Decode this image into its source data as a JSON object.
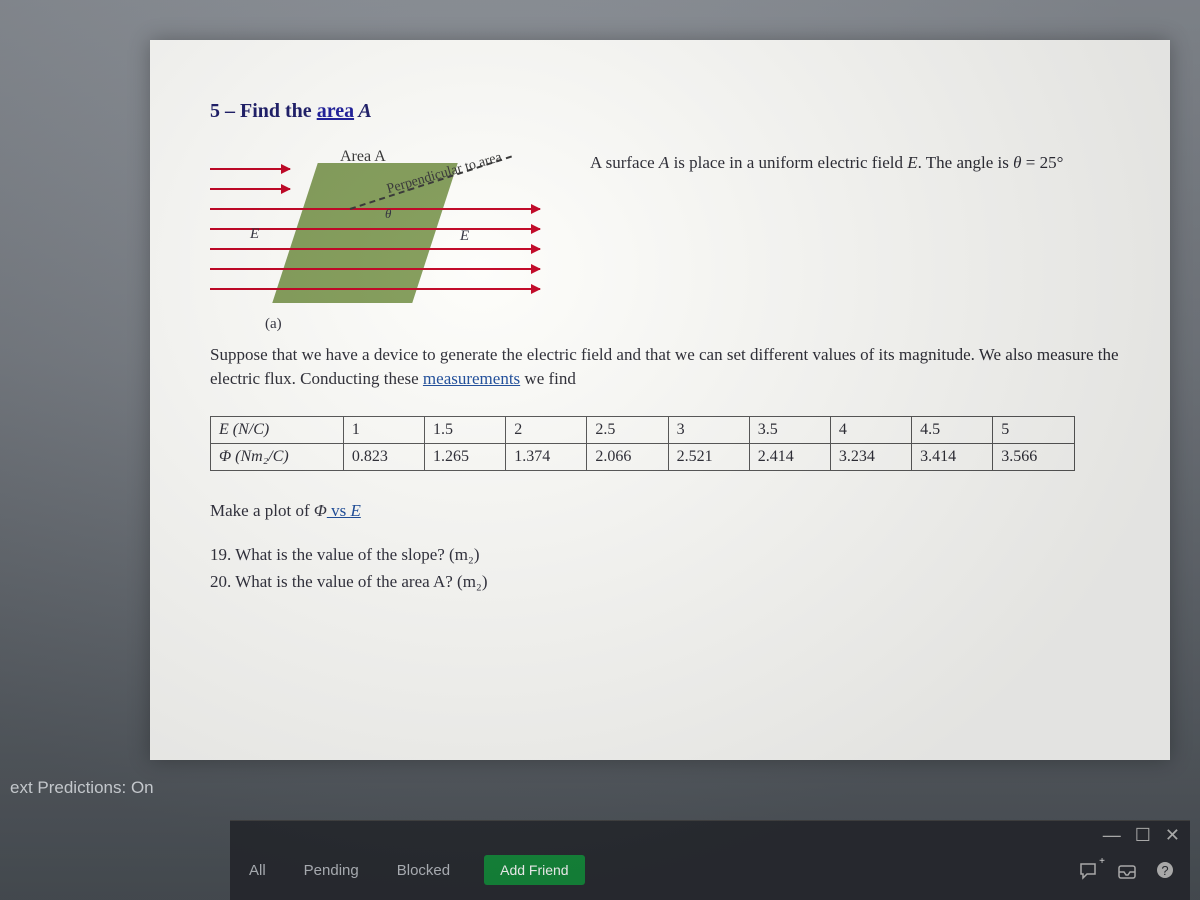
{
  "heading_num": "5 – ",
  "heading_text_prefix": "Find the ",
  "heading_area": "area",
  "heading_A": " A",
  "figure": {
    "area_label": "Area A",
    "perp_label": "Perpendicular to area",
    "theta": "θ",
    "E": "E",
    "caption": "(a)"
  },
  "right_text_1": "A surface ",
  "right_text_A": "A",
  "right_text_2": " is place in a uniform electric field ",
  "right_text_E": "E",
  "right_text_3": ". The angle is ",
  "right_text_theta": "θ",
  "right_text_eq": " = 25°",
  "body_para_1": "Suppose that we have a device to generate the electric field and that we can set different values of its magnitude. We also measure the electric flux. Conducting these ",
  "body_para_link": "measurements",
  "body_para_2": " we find",
  "table": {
    "row1_head": "E (N/C)",
    "row1": [
      "1",
      "1.5",
      "2",
      "2.5",
      "3",
      "3.5",
      "4",
      "4.5",
      "5"
    ],
    "row2_head": "Φ (Nm₂/C)",
    "row2": [
      "0.823",
      "1.265",
      "1.374",
      "2.066",
      "2.521",
      "2.414",
      "3.234",
      "3.414",
      "3.566"
    ]
  },
  "plot_line_1": "Make a plot of ",
  "plot_phi": "Φ",
  "plot_vs": " vs ",
  "plot_E": "E",
  "q19": "19. What is the value of the slope?  (m₂)",
  "q20": "20. What is the value of the area A?   (m₂)",
  "predictions_label": "ext Predictions: On",
  "chat": {
    "tab_all": "All",
    "tab_pending": "Pending",
    "tab_blocked": "Blocked",
    "add_friend": "Add Friend",
    "min": "—",
    "max": "☐",
    "close": "✕"
  },
  "chart_data": {
    "type": "table",
    "title": "Electric flux Φ vs field magnitude E",
    "columns": [
      "E (N/C)",
      "Φ (Nm²/C)"
    ],
    "rows": [
      [
        1,
        0.823
      ],
      [
        1.5,
        1.265
      ],
      [
        2,
        1.374
      ],
      [
        2.5,
        2.066
      ],
      [
        3,
        2.521
      ],
      [
        3.5,
        2.414
      ],
      [
        4,
        3.234
      ],
      [
        4.5,
        3.414
      ],
      [
        5,
        3.566
      ]
    ],
    "angle_deg": 25
  }
}
